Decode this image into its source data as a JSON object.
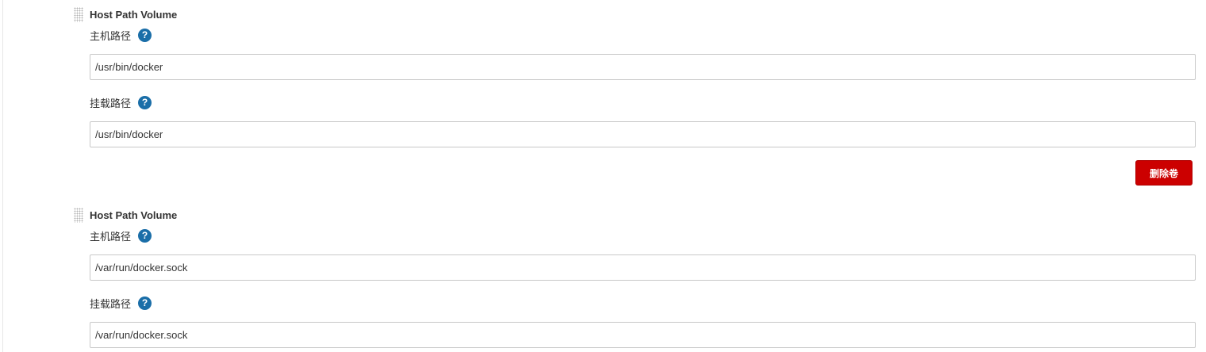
{
  "volumes": [
    {
      "title": "Host Path Volume",
      "host_path": {
        "label": "主机路径",
        "value": "/usr/bin/docker"
      },
      "mount_path": {
        "label": "挂载路径",
        "value": "/usr/bin/docker"
      },
      "delete_label": "删除卷"
    },
    {
      "title": "Host Path Volume",
      "host_path": {
        "label": "主机路径",
        "value": "/var/run/docker.sock"
      },
      "mount_path": {
        "label": "挂载路径",
        "value": "/var/run/docker.sock"
      }
    }
  ],
  "help_icon_glyph": "?",
  "colors": {
    "help_icon": "#1a6ea8",
    "delete_button": "#cc0000"
  }
}
